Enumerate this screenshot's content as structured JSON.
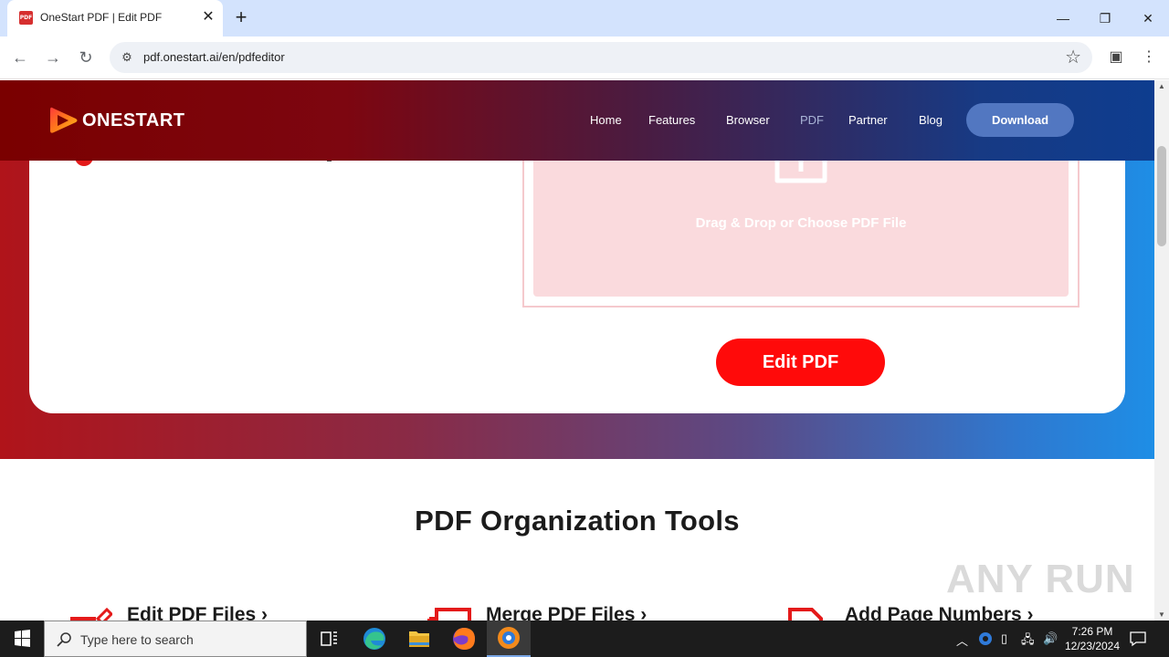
{
  "browser": {
    "tab_title": "OneStart PDF | Edit PDF",
    "tab_favicon_text": "PDF",
    "url": "pdf.onestart.ai/en/pdfeditor"
  },
  "site": {
    "logo_text": "ONESTART",
    "nav": [
      "Home",
      "Features",
      "Browser",
      "PDF",
      "Partner",
      "Blog"
    ],
    "active_nav": "PDF",
    "download_label": "Download"
  },
  "editor": {
    "drop_text": "Drag & Drop or Choose PDF File",
    "edit_button": "Edit PDF"
  },
  "tools_section": {
    "title": "PDF Organization Tools",
    "tools": [
      {
        "label": "Edit PDF Files ›",
        "icon": "edit-pdf-icon"
      },
      {
        "label": "Merge PDF Files ›",
        "icon": "merge-pdf-icon"
      },
      {
        "label": "Add Page Numbers ›",
        "icon": "page-numbers-icon"
      }
    ]
  },
  "watermark": "ANY RUN",
  "taskbar": {
    "search_placeholder": "Type here to search",
    "time": "7:26 PM",
    "date": "12/23/2024"
  },
  "colors": {
    "brand_red": "#ff0a0a",
    "download_blue": "#5277c1",
    "drop_zone": "#fadadd"
  }
}
